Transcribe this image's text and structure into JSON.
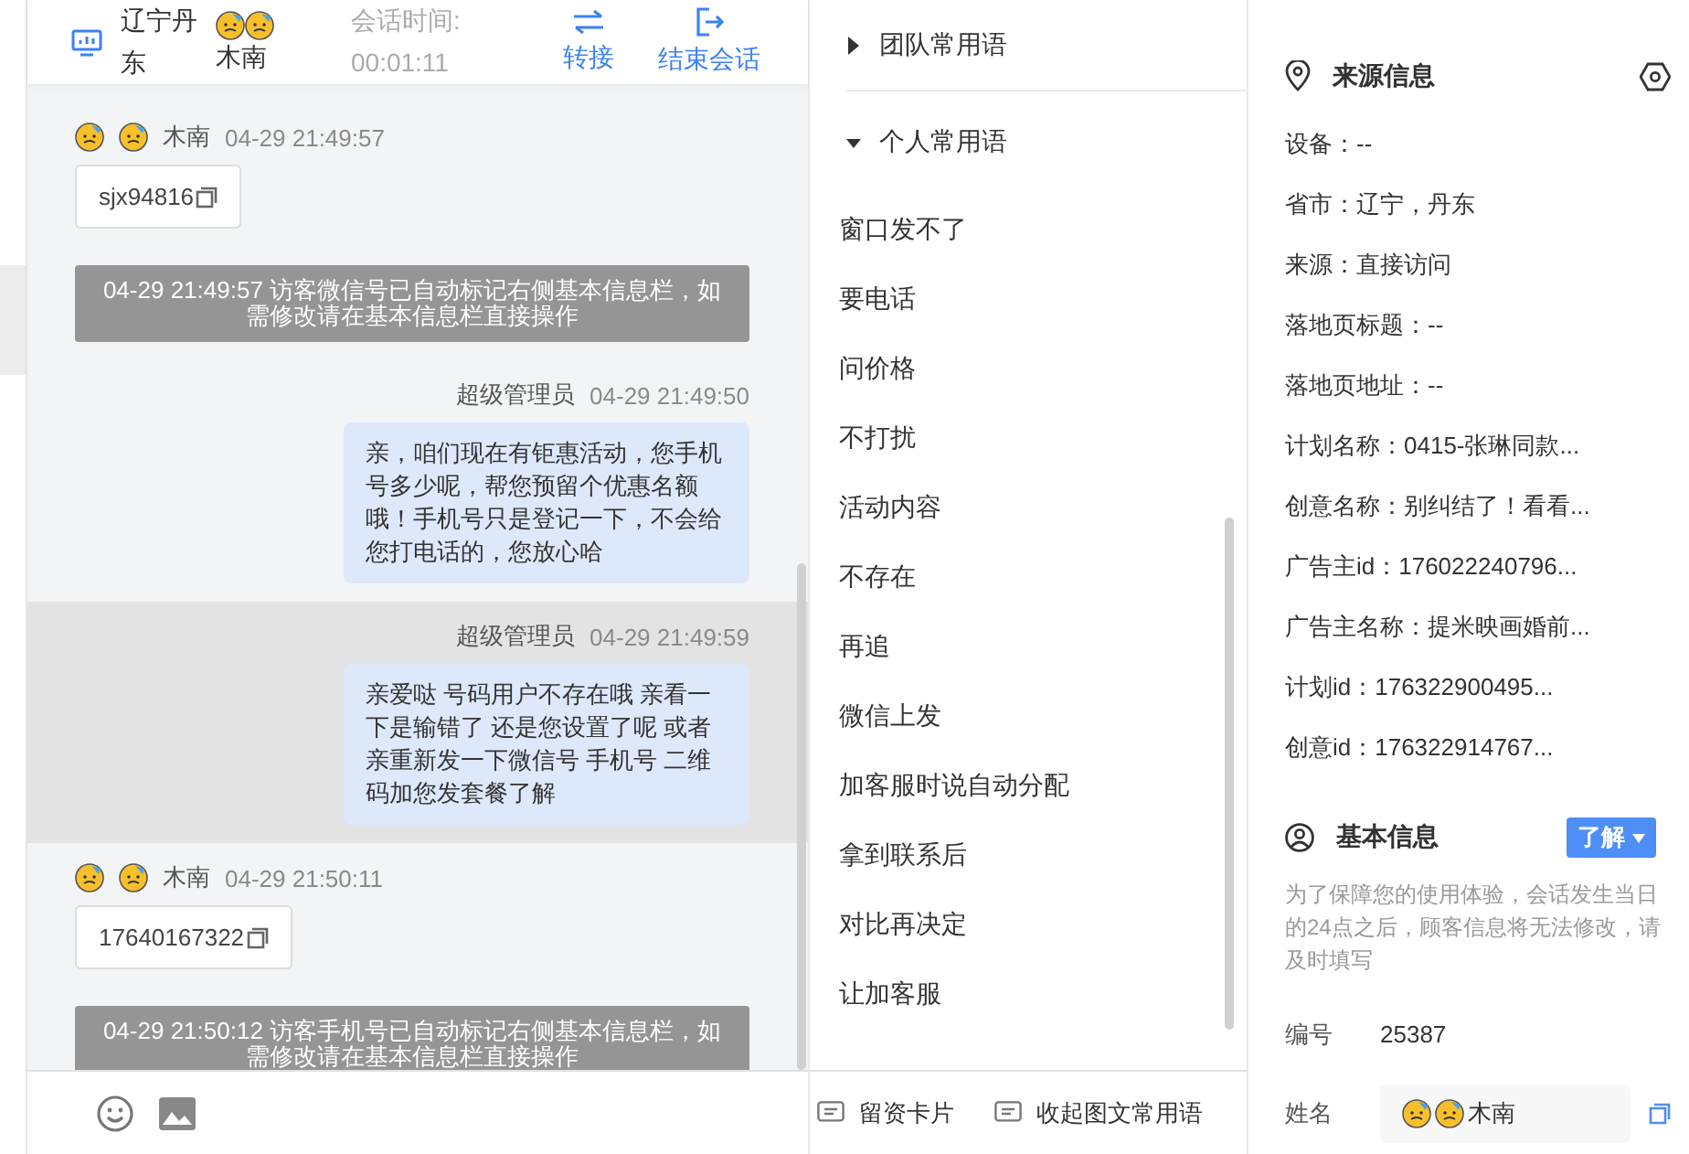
{
  "header": {
    "location": "辽宁丹东",
    "visitor": "木南",
    "session_label": "会话时间:",
    "session_time": "00:01:11",
    "actions": [
      {
        "kind": "transfer",
        "label": "转接"
      },
      {
        "kind": "end",
        "label": "结束会话"
      }
    ]
  },
  "messages": [
    {
      "kind": "visitor",
      "sender": "木南",
      "time": "04-29 21:49:57",
      "text": "sjx94816",
      "selected": false
    },
    {
      "kind": "system",
      "time": "04-29 21:49:57",
      "text": "访客微信号已自动标记右侧基本信息栏，如需修改请在基本信息栏直接操作",
      "selected": false
    },
    {
      "kind": "agent",
      "sender": "超级管理员",
      "time": "04-29 21:49:50",
      "text": "亲，咱们现在有钜惠活动，您手机号多少呢，帮您预留个优惠名额哦！手机号只是登记一下，不会给您打电话的，您放心哈",
      "selected": false
    },
    {
      "kind": "agent",
      "sender": "超级管理员",
      "time": "04-29 21:49:59",
      "text": "亲爱哒 号码用户不存在哦 亲看一下是输错了 还是您设置了呢 或者亲重新发一下微信号 手机号 二维码加您发套餐了解",
      "selected": true
    },
    {
      "kind": "visitor",
      "sender": "木南",
      "time": "04-29 21:50:11",
      "text": "17640167322",
      "selected": false
    },
    {
      "kind": "system",
      "time": "04-29 21:50:12",
      "text": "访客手机号已自动标记右侧基本信息栏，如需修改请在基本信息栏直接操作",
      "selected": false
    }
  ],
  "phrases": {
    "groups": [
      {
        "title": "团队常用语",
        "expanded": false
      },
      {
        "title": "个人常用语",
        "expanded": true
      }
    ],
    "items": [
      "窗口发不了",
      "要电话",
      "问价格",
      "不打扰",
      "活动内容",
      "不存在",
      "再追",
      "微信上发",
      "加客服时说自动分配",
      "拿到联系后",
      "对比再决定",
      "让加客服"
    ],
    "footer": [
      {
        "label": "留资卡片"
      },
      {
        "label": "收起图文常用语"
      }
    ]
  },
  "source_info": {
    "title": "来源信息",
    "fields": [
      "设备：--",
      "省市：辽宁，丹东",
      "来源：直接访问",
      "落地页标题：--",
      "落地页地址：--",
      "计划名称：0415-张琳同款...",
      "创意名称：别纠结了！看看...",
      "广告主id：176022240796...",
      "广告主名称：提米映画婚前...",
      "计划id：176322900495...",
      "创意id：176322914767..."
    ]
  },
  "basic_info": {
    "title": "基本信息",
    "button": "了解",
    "note": "为了保障您的使用体验，会话发生当日的24点之后，顾客信息将无法修改，请及时填写",
    "fields": [
      {
        "kind": "text",
        "label": "编号",
        "value": "25387"
      },
      {
        "kind": "name",
        "label": "姓名",
        "value": "木南"
      }
    ]
  }
}
